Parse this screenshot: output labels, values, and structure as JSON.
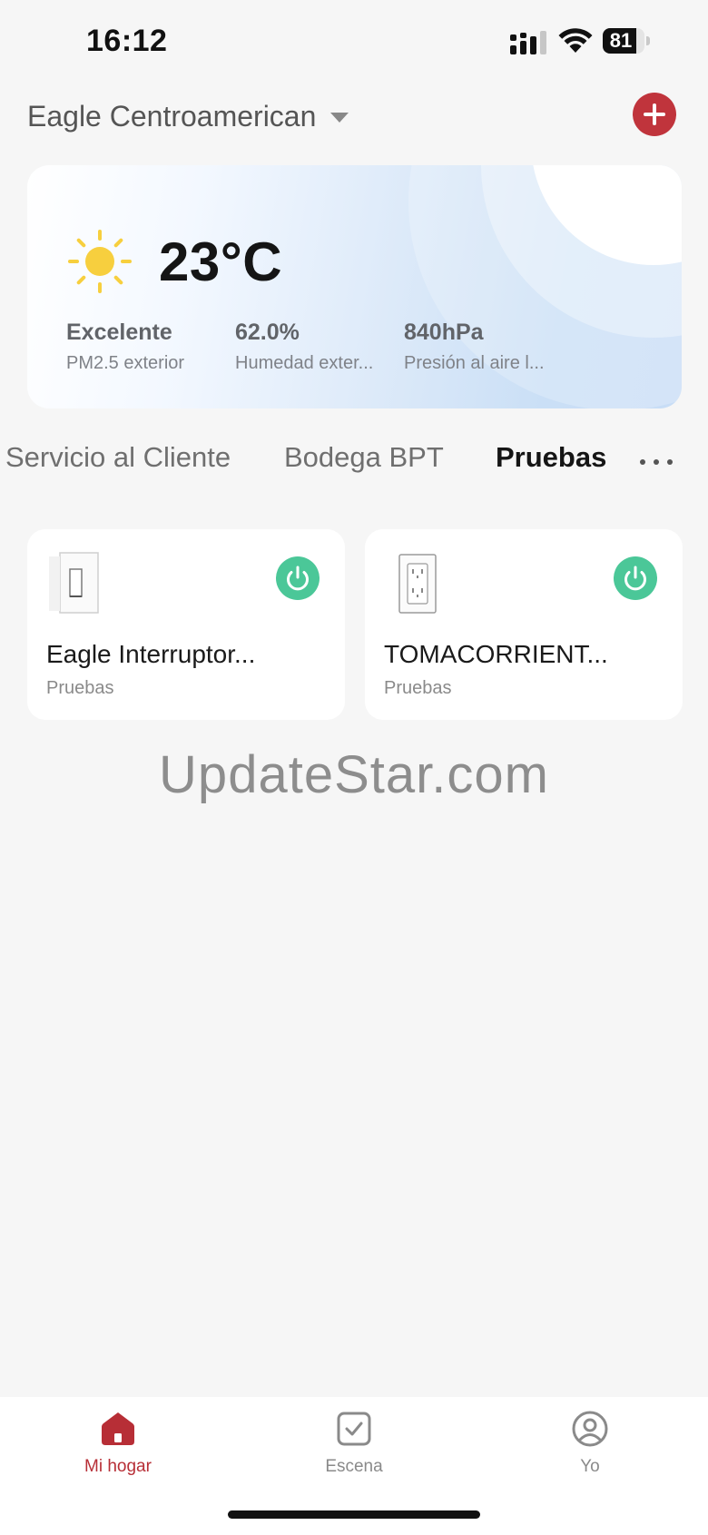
{
  "status_bar": {
    "time": "16:12",
    "battery_level": 81,
    "icons": [
      "cellular-signal-icon",
      "wifi-icon",
      "battery-icon"
    ]
  },
  "header": {
    "home_name": "Eagle Centroamerican",
    "add_button_icon": "plus-icon"
  },
  "weather": {
    "temperature": "23°C",
    "icon": "sun-icon",
    "stats": [
      {
        "value": "Excelente",
        "label": "PM2.5 exterior"
      },
      {
        "value": "62.0%",
        "label": "Humedad exter..."
      },
      {
        "value": "840hPa",
        "label": "Presión al aire l..."
      }
    ]
  },
  "rooms": {
    "tabs": [
      "Servicio al Cliente",
      "Bodega BPT",
      "Pruebas"
    ],
    "active_tab": "Pruebas",
    "more_icon": "more-horizontal-icon"
  },
  "devices": [
    {
      "name": "Eagle Interruptor...",
      "room": "Pruebas",
      "icon": "light-switch-icon",
      "power": "on"
    },
    {
      "name": "TOMACORRIENT...",
      "room": "Pruebas",
      "icon": "outlet-icon",
      "power": "on"
    }
  ],
  "watermark": "UpdateStar.com",
  "bottom_nav": {
    "items": [
      {
        "label": "Mi hogar",
        "icon": "home-icon",
        "active": true
      },
      {
        "label": "Escena",
        "icon": "scene-checkbox-icon",
        "active": false
      },
      {
        "label": "Yo",
        "icon": "user-profile-icon",
        "active": false
      }
    ]
  },
  "colors": {
    "accent": "#c0343c",
    "nav_active": "#b72e36",
    "power_on": "#4bc798",
    "sun": "#f7cf3e"
  }
}
